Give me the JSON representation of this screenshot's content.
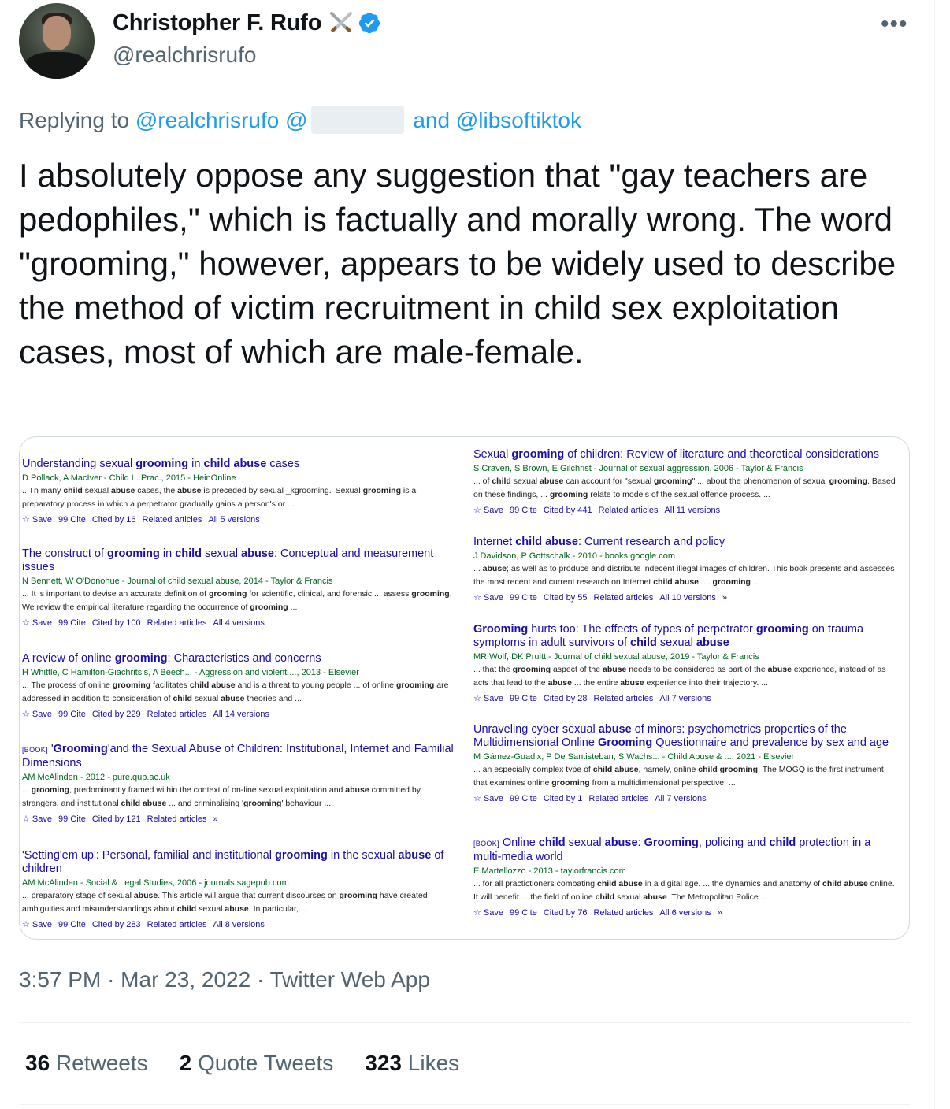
{
  "author": {
    "name": "Christopher F. Rufo",
    "handle": "@realchrisrufo",
    "badge_icon": "verified-badge-icon",
    "emoji_icon": "crossed-swords-icon",
    "verified_color": "#1d9bf0"
  },
  "more_label": "•••",
  "reply": {
    "prefix": "Replying to",
    "mention1": "@realchrisrufo",
    "mention2": "@",
    "conj": "and",
    "mention3": "@libsoftiktok"
  },
  "tweet_text": "I absolutely oppose any suggestion that \"gay teachers are pedophiles,\" which is factually and morally wrong. The word \"grooming,\" however, appears to be widely used to describe the method of victim recruitment in child sex exploitation cases, most of which are male-female.",
  "results_left": [
    {
      "title": "Understanding sexual grooming in child abuse cases",
      "authors": "D Pollack, A MacIver - Child L. Prac., 2015 - HeinOnline",
      "snippet": ".. Tn many child sexual abuse cases, the abuse is preceded by sexual _kgrooming.' Sexual grooming is a preparatory process in which a perpetrator gradually gains a person's or ...",
      "actions": [
        "☆ Save",
        "99 Cite",
        "Cited by 16",
        "Related articles",
        "All 5 versions"
      ]
    },
    {
      "title": "The construct of grooming in child sexual abuse: Conceptual and measurement issues",
      "authors": "N Bennett, W O'Donohue - Journal of child sexual abuse, 2014 - Taylor & Francis",
      "snippet": "... It is important to devise an accurate definition of grooming for scientific, clinical, and forensic ... assess grooming. We review the empirical literature regarding the occurrence of grooming ...",
      "actions": [
        "☆ Save",
        "99 Cite",
        "Cited by 100",
        "Related articles",
        "All 4 versions"
      ]
    },
    {
      "title": "A review of online grooming: Characteristics and concerns",
      "authors": "H Whittle, C Hamilton-Giachritsis, A Beech... - Aggression and violent ..., 2013 - Elsevier",
      "snippet": "... The process of online grooming facilitates child abuse and is a threat to young people ... of online grooming are addressed in addition to consideration of child sexual abuse theories and ...",
      "actions": [
        "☆ Save",
        "99 Cite",
        "Cited by 229",
        "Related articles",
        "All 14 versions"
      ]
    },
    {
      "book_tag": "[BOOK]",
      "title": "'Grooming'and the Sexual Abuse of Children: Institutional, Internet and Familial Dimensions",
      "authors": "AM McAlinden - 2012 - pure.qub.ac.uk",
      "snippet": "... grooming, predominantly framed within the context of on-line sexual exploitation and abuse committed by strangers, and institutional child abuse ... and criminalising 'grooming' behaviour ...",
      "actions": [
        "☆ Save",
        "99 Cite",
        "Cited by 121",
        "Related articles",
        "»"
      ]
    },
    {
      "title": "'Setting'em up': Personal, familial and institutional grooming in the sexual abuse of children",
      "authors": "AM McAlinden - Social & Legal Studies, 2006 - journals.sagepub.com",
      "snippet": "... preparatory stage of sexual abuse. This article will argue that current discourses on grooming have created ambiguities and misunderstandings about child sexual abuse. In particular, ...",
      "actions": [
        "☆ Save",
        "99 Cite",
        "Cited by 283",
        "Related articles",
        "All 8 versions"
      ]
    }
  ],
  "results_right": [
    {
      "title": "Sexual grooming of children: Review of literature and theoretical considerations",
      "authors": "S Craven, S Brown, E Gilchrist - Journal of sexual aggression, 2006 - Taylor & Francis",
      "snippet": "... of child sexual abuse can account for \"sexual grooming\" ... about the phenomenon of sexual grooming. Based on these findings, ... grooming relate to models of the sexual offence process. ...",
      "actions": [
        "☆ Save",
        "99 Cite",
        "Cited by 441",
        "Related articles",
        "All 11 versions"
      ]
    },
    {
      "title": "Internet child abuse: Current research and policy",
      "authors": "J Davidson, P Gottschalk - 2010 - books.google.com",
      "snippet": "... abuse; as well as to produce and distribute indecent illegal images of children. This book presents and assesses the most recent and current research on Internet child abuse, ... grooming ...",
      "actions": [
        "☆ Save",
        "99 Cite",
        "Cited by 55",
        "Related articles",
        "All 10 versions",
        "»"
      ]
    },
    {
      "title": "Grooming hurts too: The effects of types of perpetrator grooming on trauma symptoms in adult survivors of child sexual abuse",
      "authors": "MR Wolf, DK Pruitt - Journal of child sexual abuse, 2019 - Taylor & Francis",
      "snippet": "... that the grooming aspect of the abuse needs to be considered as part of the abuse experience, instead of as acts that lead to the abuse ... the entire abuse experience into their trajectory. ...",
      "actions": [
        "☆ Save",
        "99 Cite",
        "Cited by 28",
        "Related articles",
        "All 7 versions"
      ]
    },
    {
      "title": "Unraveling cyber sexual abuse of minors: psychometrics properties of the Multidimensional Online Grooming Questionnaire and prevalence by sex and age",
      "authors": "M Gámez-Guadix, P De Santisteban, S Wachs... - Child Abuse & ..., 2021 - Elsevier",
      "snippet": "... an especially complex type of child abuse, namely, online child grooming. The MOGQ is the first instrument that examines online grooming from a multidimensional perspective, ...",
      "actions": [
        "☆ Save",
        "99 Cite",
        "Cited by 1",
        "Related articles",
        "All 7 versions"
      ]
    },
    {
      "book_tag": "[BOOK]",
      "title": "Online child sexual abuse: Grooming, policing and child protection in a multi-media world",
      "authors": "E Martellozzo - 2013 - taylorfrancis.com",
      "snippet": "... for all practictioners combating child abuse in a digital age. ... the dynamics and anatomy of child abuse online. It will benefit ... the field of online child sexual abuse. The Metropolitan Police ...",
      "actions": [
        "☆ Save",
        "99 Cite",
        "Cited by 76",
        "Related articles",
        "All 6 versions",
        "»"
      ]
    }
  ],
  "meta": {
    "time": "3:57 PM",
    "sep": "·",
    "date": "Mar 23, 2022",
    "source": "Twitter Web App"
  },
  "stats": {
    "retweets_count": "36",
    "retweets_label": "Retweets",
    "quotes_count": "2",
    "quotes_label": "Quote Tweets",
    "likes_count": "323",
    "likes_label": "Likes"
  }
}
